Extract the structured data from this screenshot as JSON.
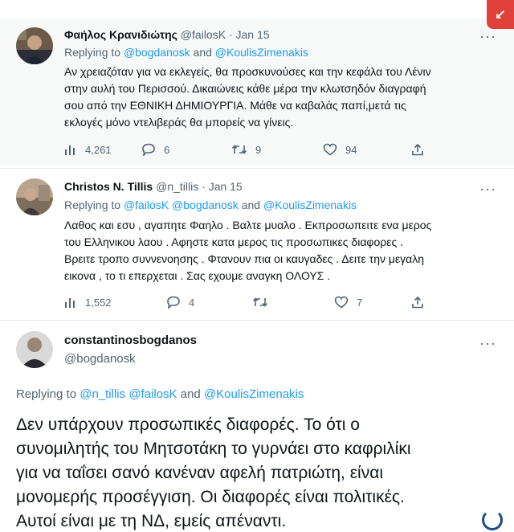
{
  "tweets": [
    {
      "name": "Φαήλος Κρανιδιώτης",
      "handle": "@failosK",
      "sep": "·",
      "date": "Jan 15",
      "reply_prefix": "Replying to",
      "mention1": "@bogdanosk",
      "reply_and": "and",
      "mention2": "@KoulisZimenakis",
      "text_lines": [
        "Αν χρειαζόταν για να εκλεγείς, θα προσκυνούσες και την κεφάλα του Λένιν",
        "στην αυλή του Περισσού. Δικαιώνεις κάθε μέρα την κλωτσηδόν διαγραφή",
        "σου από την ΕΘΝΙΚΗ ΔΗΜΙΟΥΡΓΙΑ. Μάθε να καβαλάς παπί,μετά τις",
        "εκλογές μόνο ντελιβεράς θα μπορείς να γίνεις."
      ],
      "views": "4,261",
      "replies": "6",
      "retweets": "9",
      "likes": "94"
    },
    {
      "name": "Christos N. Tillis",
      "handle": "@n_tillis",
      "sep": "·",
      "date": "Jan 15",
      "reply_prefix": "Replying to",
      "mention0": "@failosK",
      "mention1": "@bogdanosk",
      "reply_and": "and",
      "mention2": "@KoulisZimenakis",
      "text_lines": [
        "Λαθος και εσυ , αγαπητε Φαηλο . Βαλτε μυαλο . Εκπροσωπειτε ενα μερος",
        "του Ελληνικου λαου . Αφηστε κατα μερος τις προσωπικες διαφορες .",
        "Βρειτε τροπο συννενοησης . Φτανουν πια οι καυγαδες . Δειτε την μεγαλη",
        "εικονα , το τι επερχεται . Σας εχουμε αναγκη ΟΛΟΥΣ ."
      ],
      "views": "1,552",
      "replies": "4",
      "retweets": "",
      "likes": "7"
    },
    {
      "name": "constantinosbogdanos",
      "handle": "@bogdanosk",
      "reply_prefix": "Replying to",
      "mention0": "@n_tillis",
      "mention1": "@failosK",
      "reply_and": "and",
      "mention2": "@KoulisZimenakis",
      "text_lines": [
        "Δεν υπάρχουν προσωπικές διαφορές. Το ότι ο",
        "συνομιλητής του Μητσοτάκη το γυρνάει στο καφριλίκι",
        "για να ταΐσει σανό κανέναν αφελή πατριώτη, είναι",
        "μονομερής προσέγγιση. Οι διαφορές είναι πολιτικές.",
        "Αυτοί είναι με τη ΝΔ, εμείς απέναντι."
      ]
    }
  ],
  "more_label": "···",
  "icons": [
    "views-icon",
    "reply-icon",
    "retweet-icon",
    "like-icon",
    "share-icon"
  ],
  "colors": {
    "accent": "#1d9bf0",
    "muted": "#536471",
    "text": "#0f1419",
    "badge": "#e0413a"
  }
}
